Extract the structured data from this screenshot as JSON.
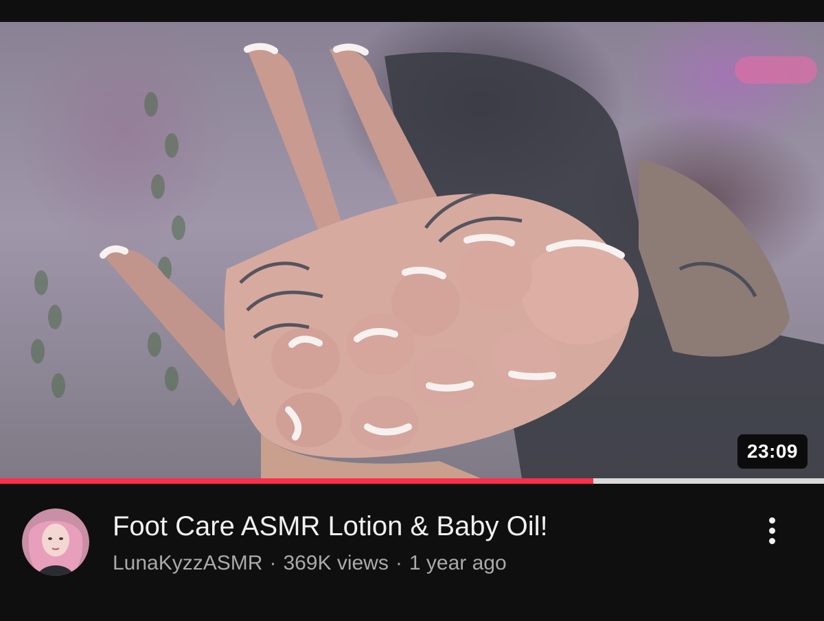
{
  "video": {
    "duration": "23:09",
    "progress_fraction": 0.72,
    "title": "Foot Care ASMR Lotion & Baby Oil!",
    "channel": "LunaKyzzASMR",
    "views": "369K views",
    "age": "1 year ago",
    "separator": "·"
  },
  "colors": {
    "progress": "#ff2e4c",
    "track": "#d9d9d9",
    "background": "#0f0f0f",
    "title": "#f1f1f1",
    "meta": "#aaaaaa"
  },
  "icons": {
    "more": "vertical-ellipsis-icon"
  }
}
